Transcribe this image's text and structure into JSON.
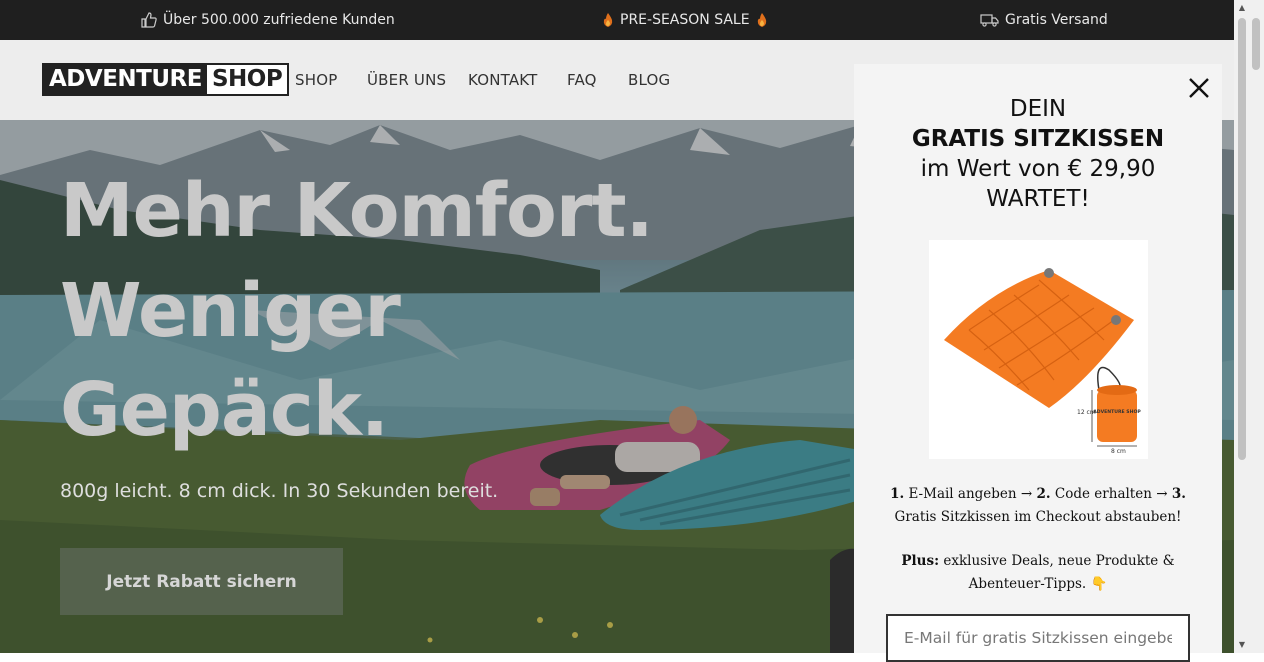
{
  "topbar": {
    "customers": "Über 500.000 zufriedene Kunden",
    "sale": "PRE-SEASON SALE",
    "shipping": "Gratis Versand"
  },
  "header": {
    "logo_left": "ADVENTURE",
    "logo_right": "SHOP",
    "nav": [
      "SHOP",
      "ÜBER UNS",
      "KONTAKT",
      "FAQ",
      "BLOG"
    ]
  },
  "hero": {
    "headline": [
      "Mehr Komfort.",
      "Weniger",
      "Gepäck."
    ],
    "subtitle": "800g leicht. 8 cm dick. In 30 Sekunden bereit.",
    "cta": "Jetzt Rabatt sichern"
  },
  "popup": {
    "line1": "DEIN",
    "line2": "GRATIS SITZKISSEN",
    "line3": "im Wert von € 29,90",
    "line4": "WARTET!",
    "product_brand": "ADVENTURE SHOP",
    "product_dim_h": "12 cm",
    "product_dim_w": "8 cm",
    "steps": {
      "n1": "1.",
      "s1": "E-Mail angeben",
      "n2": "2.",
      "s2": "Code erhalten",
      "n3": "3.",
      "s3": "Gratis Sitzkissen im Checkout abstauben!"
    },
    "plus_label": "Plus:",
    "plus_text": "exklusive Deals, neue Produkte & Abenteuer-Tipps. 👇",
    "email_placeholder": "E-Mail für gratis Sitzkissen eingeben"
  },
  "colors": {
    "topbar_bg": "#1f1f1f",
    "cta_bg": "#55624d",
    "popup_bg": "#f4f4f4",
    "product_orange": "#f47b22"
  },
  "icons": [
    "thumbs-up-icon",
    "fire-icon",
    "truck-icon",
    "close-icon"
  ]
}
